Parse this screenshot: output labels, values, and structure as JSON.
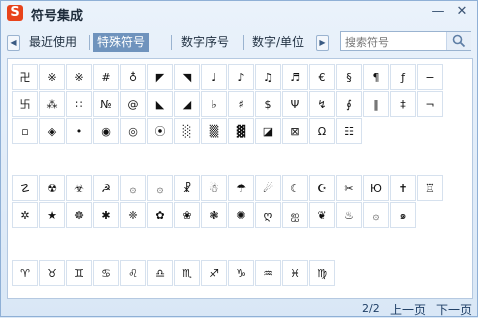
{
  "window": {
    "title": "符号集成",
    "app_icon_letter": "S",
    "minimize_glyph": "—",
    "close_glyph": "✕"
  },
  "tabs": [
    {
      "label": "最近使用"
    },
    {
      "label": "特殊符号"
    },
    {
      "label": "数字序号"
    },
    {
      "label": "数字/单位"
    }
  ],
  "active_tab": "特殊符号",
  "search": {
    "placeholder": "搜索符号"
  },
  "symbols_group1": [
    "卍",
    "※",
    "※",
    "#",
    "♁",
    "◤",
    "◥",
    "♩",
    "♪",
    "♫",
    "♬",
    "€",
    "§",
    "¶",
    "ƒ",
    "−",
    "卐",
    "⁂",
    "∷",
    "№",
    "@",
    "◣",
    "◢",
    "♭",
    "♯",
    "$",
    "Ψ",
    "↯",
    "∮",
    "‖",
    "‡",
    "¬",
    "▫",
    "◈",
    "•",
    "◉",
    "◎",
    "⦿",
    "░",
    "▒",
    "▓",
    "◪",
    "⊠",
    "Ω",
    "☷"
  ],
  "symbols_group2": [
    "☡",
    "☢",
    "☣",
    "☭",
    "۞",
    "۞",
    "☧",
    "☃",
    "☂",
    "☄",
    "☾",
    "☪",
    "✂",
    "Ю",
    "✝",
    "♖",
    "✲",
    "★",
    "☸",
    "✱",
    "❈",
    "✿",
    "❀",
    "❃",
    "✺",
    "ღ",
    "ஐ",
    "❦",
    "♨",
    "۞",
    "๑"
  ],
  "symbols_group3": [
    "♈",
    "♉",
    "♊",
    "♋",
    "♌",
    "♎",
    "♏",
    "♐",
    "♑",
    "♒",
    "♓",
    "♍"
  ],
  "footer": {
    "page": "2/2",
    "prev": "上一页",
    "next": "下一页"
  }
}
